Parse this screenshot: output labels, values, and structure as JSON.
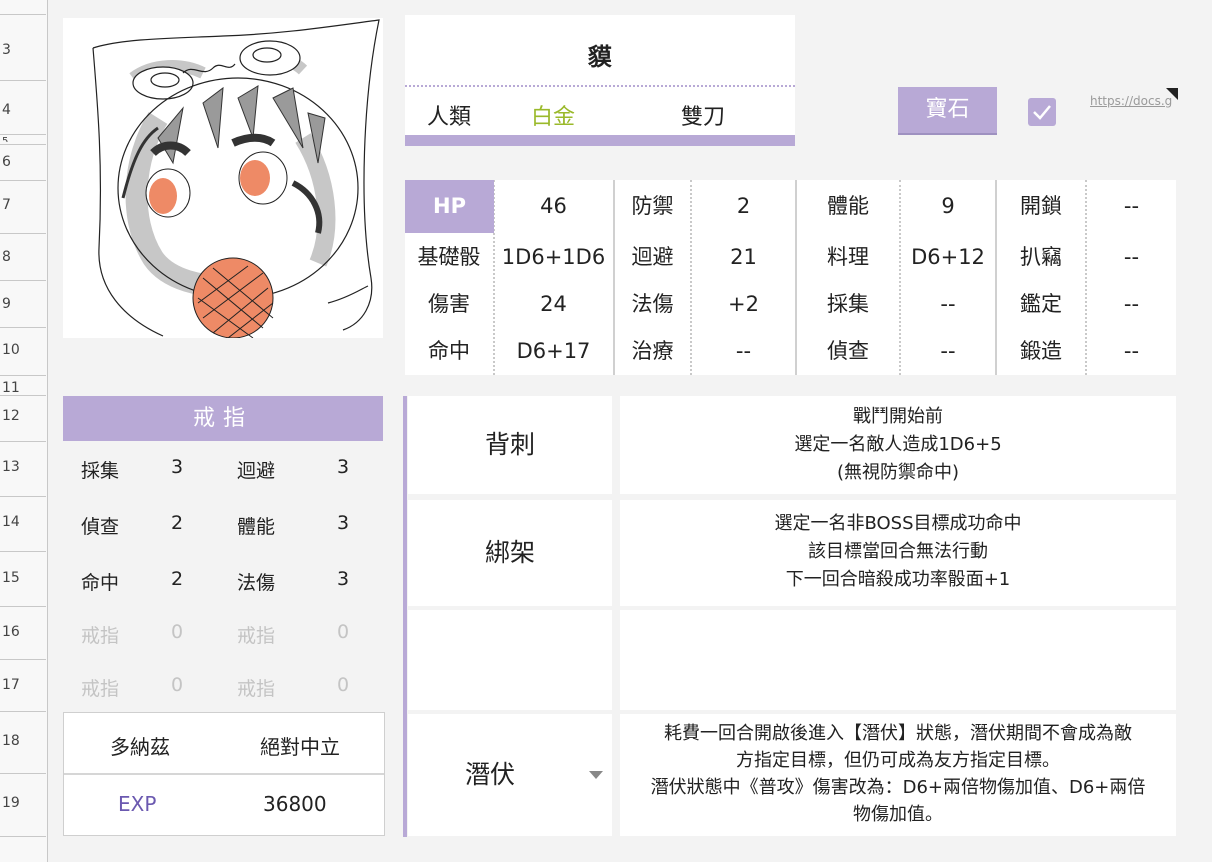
{
  "row_numbers": [
    "3",
    "4",
    "5",
    "6",
    "7",
    "8",
    "9",
    "10",
    "11",
    "12",
    "13",
    "14",
    "15",
    "16",
    "17",
    "18",
    "19"
  ],
  "character": {
    "name": "貘",
    "race": "人類",
    "rank": "白金",
    "weapon": "雙刀",
    "rank_color": "#9ab92a"
  },
  "gem_button": "寶石",
  "checkbox_checked": true,
  "link_text": "https://docs.google.com/",
  "stats": [
    [
      {
        "k": "HP",
        "v": "46"
      },
      {
        "k": "防禦",
        "v": "2"
      },
      {
        "k": "體能",
        "v": "9"
      },
      {
        "k": "開鎖",
        "v": "--"
      }
    ],
    [
      {
        "k": "基礎骰",
        "v": "1D6+1D6"
      },
      {
        "k": "迴避",
        "v": "21"
      },
      {
        "k": "料理",
        "v": "D6+12"
      },
      {
        "k": "扒竊",
        "v": "--"
      }
    ],
    [
      {
        "k": "傷害",
        "v": "24"
      },
      {
        "k": "法傷",
        "v": "+2"
      },
      {
        "k": "採集",
        "v": "--"
      },
      {
        "k": "鑑定",
        "v": "--"
      }
    ],
    [
      {
        "k": "命中",
        "v": "D6+17"
      },
      {
        "k": "治療",
        "v": "--"
      },
      {
        "k": "偵查",
        "v": "--"
      },
      {
        "k": "鍛造",
        "v": "--"
      }
    ]
  ],
  "ring": {
    "header": "戒指",
    "rows": [
      {
        "a": "採集",
        "av": "3",
        "b": "迴避",
        "bv": "3"
      },
      {
        "a": "偵查",
        "av": "2",
        "b": "體能",
        "bv": "3"
      },
      {
        "a": "命中",
        "av": "2",
        "b": "法傷",
        "bv": "3"
      },
      {
        "a": "戒指",
        "av": "0",
        "b": "戒指",
        "bv": "0"
      },
      {
        "a": "戒指",
        "av": "0",
        "b": "戒指",
        "bv": "0"
      }
    ]
  },
  "faith": {
    "god": "多納茲",
    "alignment": "絕對中立"
  },
  "exp": {
    "label": "EXP",
    "value": "36800"
  },
  "skills": [
    {
      "name": "背刺",
      "desc": [
        "戰鬥開始前",
        "選定一名敵人造成1D6+5",
        "(無視防禦命中)"
      ]
    },
    {
      "name": "綁架",
      "desc": [
        "選定一名非BOSS目標成功命中",
        "該目標當回合無法行動",
        "下一回合暗殺成功率骰面+1"
      ]
    },
    {
      "name": "",
      "desc": []
    },
    {
      "name": "潛伏",
      "desc": [
        "耗費一回合開啟後進入【潛伏】狀態，潛伏期間不會成為敵",
        "方指定目標，但仍可成為友方指定目標。",
        "潛伏狀態中《普攻》傷害改為：D6+兩倍物傷加值、D6+兩倍",
        "物傷加值。"
      ]
    }
  ]
}
